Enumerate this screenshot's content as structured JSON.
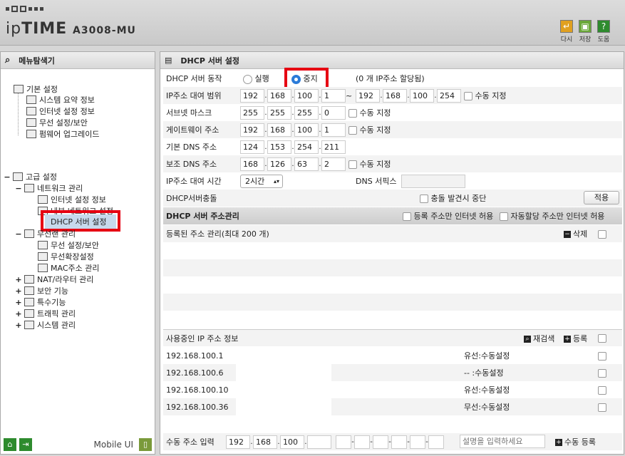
{
  "header": {
    "brand_prefix": "ip",
    "brand_bold": "TIME",
    "model": "A3008-MU",
    "buttons": {
      "reload": "다시",
      "save": "저장",
      "help": "도움"
    }
  },
  "left": {
    "title": "메뉴탐색기",
    "basic": {
      "label": "기본 설정",
      "items": [
        "시스템 요약 정보",
        "인터넷 설정 정보",
        "무선 설정/보안",
        "펌웨어 업그레이드"
      ]
    },
    "advanced": {
      "label": "고급 설정"
    },
    "network": {
      "label": "네트워크 관리",
      "items": [
        "인터넷 설정 정보",
        "내부 네트워크 설정",
        "DHCP 서버 설정"
      ]
    },
    "wireless": {
      "label": "무선랜 관리",
      "items": [
        "무선 설정/보안",
        "무선확장설정",
        "MAC주소 관리"
      ]
    },
    "others": [
      "NAT/라우터 관리",
      "보안 기능",
      "특수기능",
      "트래픽 관리",
      "시스템 관리"
    ],
    "footer": {
      "mobile": "Mobile UI"
    }
  },
  "right": {
    "title": "DHCP 서버 설정",
    "server_action": {
      "label": "DHCP 서버 동작",
      "run": "실행",
      "stop": "중지",
      "note": "(0 개 IP주소 할당됨)"
    },
    "lease_range": {
      "label": "IP주소 대여 범위",
      "start": [
        "192",
        "168",
        "100",
        "1"
      ],
      "tilde": "~",
      "end": [
        "192",
        "168",
        "100",
        "254"
      ],
      "manual": "수동 지정"
    },
    "subnet": {
      "label": "서브넷 마스크",
      "value": [
        "255",
        "255",
        "255",
        "0"
      ],
      "manual": "수동 지정"
    },
    "gateway": {
      "label": "게이트웨이 주소",
      "value": [
        "192",
        "168",
        "100",
        "1"
      ],
      "manual": "수동 지정"
    },
    "dns1": {
      "label": "기본 DNS 주소",
      "value": [
        "124",
        "153",
        "254",
        "211"
      ]
    },
    "dns2": {
      "label": "보조 DNS 주소",
      "value": [
        "168",
        "126",
        "63",
        "2"
      ],
      "manual": "수동 지정"
    },
    "lease_time": {
      "label": "IP주소 대여 시간",
      "value": "2시간",
      "dns_suffix": "DNS 서픽스"
    },
    "conflict": {
      "label": "DHCP서버충돌",
      "stop": "충돌 발견시 중단",
      "apply": "적용"
    },
    "addr_mgmt": {
      "title": "DHCP 서버 주소관리",
      "reg_only": "등록 주소만 인터넷 허용",
      "auto_only": "자동할당 주소만 인터넷 허용"
    },
    "registered": {
      "title": "등록된 주소 관리(최대 200 개)",
      "delete": "삭제"
    },
    "in_use": {
      "title": "사용중인 IP 주소 정보",
      "rescan": "재검색",
      "register": "등록",
      "rows": [
        {
          "ip": "192.168.100.1",
          "type": "유선:수동설정"
        },
        {
          "ip": "192.168.100.6",
          "type": "-- :수동설정"
        },
        {
          "ip": "192.168.100.10",
          "type": "유선:수동설정"
        },
        {
          "ip": "192.168.100.36",
          "type": "무선:수동설정"
        }
      ]
    },
    "manual_input": {
      "label": "수동 주소 입력",
      "ip": [
        "192",
        "168",
        "100",
        ""
      ],
      "desc_placeholder": "설명을 입력하세요",
      "register": "수동 등록"
    }
  },
  "colors": {
    "highlight": "#e60012",
    "selected": "#2b7bd8",
    "green": "#2e8b2e"
  }
}
